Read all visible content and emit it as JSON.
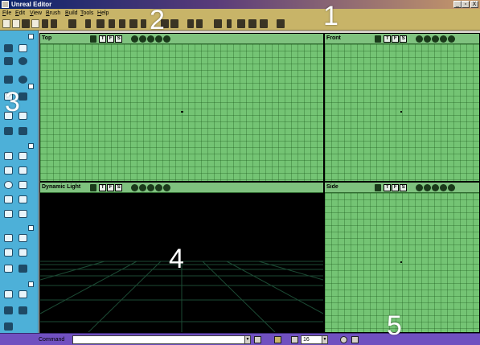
{
  "window": {
    "title": "Unreal Editor",
    "controls": [
      "_",
      "▫",
      "X"
    ]
  },
  "menu": {
    "items": [
      "File",
      "Edit",
      "View",
      "Brush",
      "Build",
      "Tools",
      "Help"
    ]
  },
  "toolbar": {
    "background": "#c8b468"
  },
  "viewports": [
    {
      "id": "top",
      "title": "Top",
      "mode": "grid",
      "buttons": [
        "T",
        "F",
        "S"
      ]
    },
    {
      "id": "front",
      "title": "Front",
      "mode": "grid",
      "buttons": [
        "T",
        "F",
        "S"
      ]
    },
    {
      "id": "dynamic",
      "title": "Dynamic Light",
      "mode": "3d",
      "buttons": [
        "T",
        "F",
        "S"
      ]
    },
    {
      "id": "side",
      "title": "Side",
      "mode": "grid",
      "buttons": [
        "T",
        "F",
        "S"
      ]
    }
  ],
  "statusbar": {
    "command_label": "Command",
    "command_value": "",
    "grid_size": "16"
  },
  "markers": [
    "1",
    "2",
    "3",
    "4",
    "5"
  ],
  "colors": {
    "viewport_green": "#74c474",
    "leftbar_blue": "#4db0d8",
    "statusbar_purple": "#7050c0",
    "titlebar": "#0a246a"
  }
}
